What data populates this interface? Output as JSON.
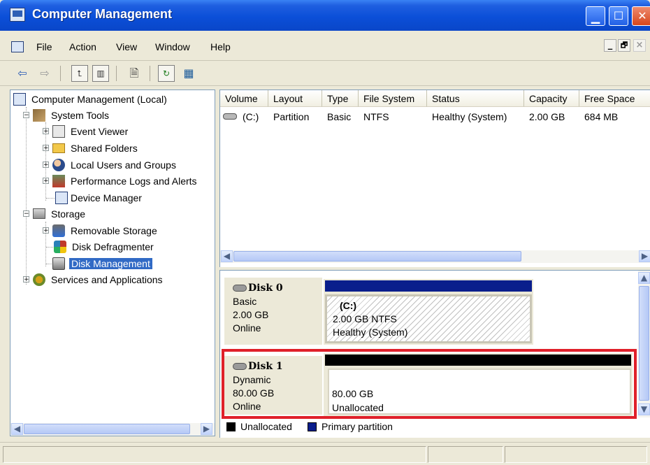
{
  "window": {
    "title": "Computer Management"
  },
  "menu": [
    "File",
    "Action",
    "View",
    "Window",
    "Help"
  ],
  "mdi_controls": [
    "_",
    "🗗",
    "×"
  ],
  "toolbar": [
    "back",
    "forward",
    "up-one-level",
    "show-hide-tree",
    "properties",
    "refresh",
    "export-list"
  ],
  "tree": {
    "root": "Computer Management (Local)",
    "items": [
      {
        "label": "System Tools",
        "expander": "−"
      },
      {
        "label": "Event Viewer",
        "expander": "+"
      },
      {
        "label": "Shared Folders",
        "expander": "+"
      },
      {
        "label": "Local Users and Groups",
        "expander": "+"
      },
      {
        "label": "Performance Logs and Alerts",
        "expander": "+"
      },
      {
        "label": "Device Manager",
        "expander": ""
      },
      {
        "label": "Storage",
        "expander": "−"
      },
      {
        "label": "Removable Storage",
        "expander": "+"
      },
      {
        "label": "Disk Defragmenter",
        "expander": ""
      },
      {
        "label": "Disk Management",
        "expander": "",
        "selected": true
      },
      {
        "label": "Services and Applications",
        "expander": "+"
      }
    ]
  },
  "volume_list": {
    "columns": [
      "Volume",
      "Layout",
      "Type",
      "File System",
      "Status",
      "Capacity",
      "Free Space"
    ],
    "rows": [
      {
        "volume": "(C:)",
        "layout": "Partition",
        "type": "Basic",
        "filesystem": "NTFS",
        "status": "Healthy (System)",
        "capacity": "2.00 GB",
        "free": "684 MB"
      }
    ]
  },
  "disks": [
    {
      "name": "Disk 0",
      "type": "Basic",
      "size": "2.00 GB",
      "state": "Online",
      "partition": {
        "label": "(C:)",
        "detail": "2.00 GB NTFS",
        "status": "Healthy (System)"
      }
    },
    {
      "name": "Disk 1",
      "type": "Dynamic",
      "size": "80.00 GB",
      "state": "Online",
      "highlighted": true,
      "partition": {
        "detail": "80.00 GB",
        "status": "Unallocated"
      }
    }
  ],
  "legend": [
    {
      "label": "Unallocated",
      "color": "#000000"
    },
    {
      "label": "Primary partition",
      "color": "#0a1e8c"
    }
  ],
  "colors": {
    "highlight_box": "#e0202a",
    "selection": "#316ac5",
    "primary_bar": "#0a1e8c"
  }
}
